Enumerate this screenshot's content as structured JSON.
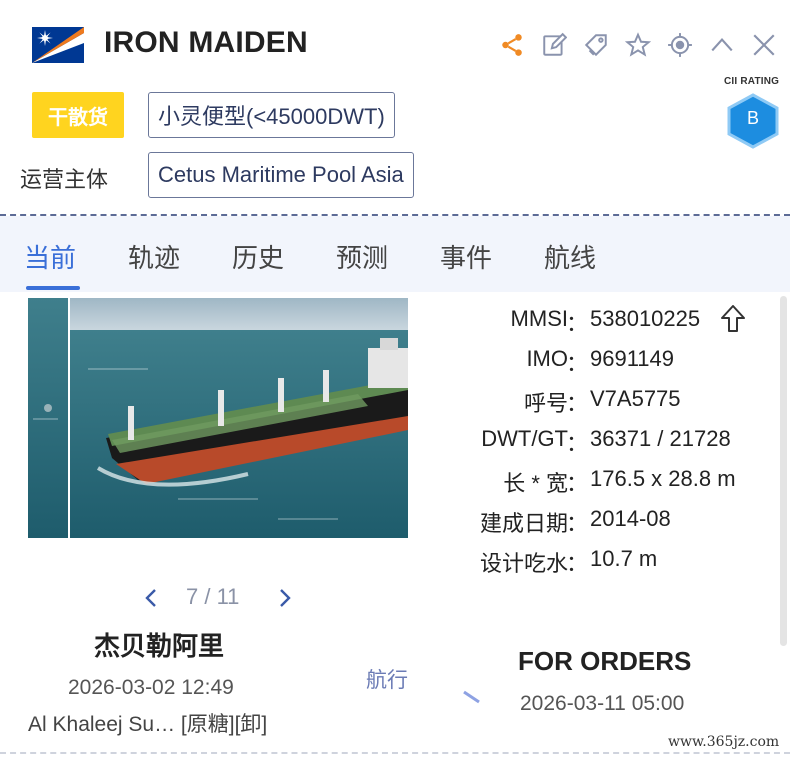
{
  "header": {
    "ship_name": "IRON MAIDEN",
    "flag": "marshall-islands-flag",
    "icons": [
      "share-icon",
      "edit-icon",
      "tag-icon",
      "star-icon",
      "locate-icon",
      "collapse-icon",
      "close-icon"
    ],
    "accent_color": "#f08a24"
  },
  "tags": {
    "ship_type": "干散货",
    "size_class": "小灵便型(<45000DWT)",
    "operator_label": "运营主体",
    "operator_value": "Cetus Maritime Pool Asia"
  },
  "cii": {
    "label": "CII RATING",
    "rating": "B",
    "color": "#1d8de0"
  },
  "tabs": [
    {
      "label": "当前",
      "active": true
    },
    {
      "label": "轨迹",
      "active": false
    },
    {
      "label": "历史",
      "active": false
    },
    {
      "label": "预测",
      "active": false
    },
    {
      "label": "事件",
      "active": false
    },
    {
      "label": "航线",
      "active": false
    }
  ],
  "photo": {
    "pager": "7 / 11"
  },
  "info": [
    {
      "label": "MMSI",
      "value": "538010225"
    },
    {
      "label": "IMO",
      "value": "9691149"
    },
    {
      "label": "呼号",
      "value": "V7A5775"
    },
    {
      "label": "DWT/GT",
      "value": "36371 / 21728"
    },
    {
      "label": "长 * 宽",
      "value": "176.5 x 28.8 m"
    },
    {
      "label": "建成日期",
      "value": "2014-08"
    },
    {
      "label": "设计吃水",
      "value": "10.7 m"
    }
  ],
  "colon": "：",
  "voyage": {
    "departure_port": "杰贝勒阿里",
    "departure_time": "2026-03-02 12:49",
    "departure_place": "Al Khaleej Su…  [原糖][卸]",
    "status": "航行",
    "arrival_port": "FOR ORDERS",
    "arrival_time": "2026-03-11 05:00"
  },
  "watermark": "www.365jz.com"
}
